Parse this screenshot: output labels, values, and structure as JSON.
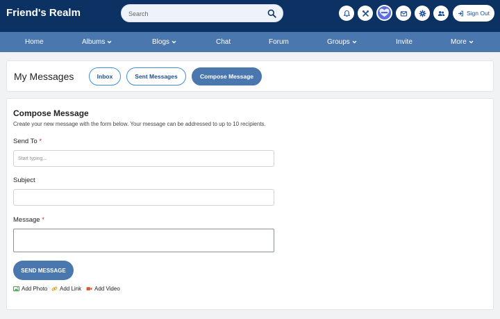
{
  "header": {
    "brand": "Friend's Realm",
    "search_placeholder": "Search",
    "signout_label": "Sign Out"
  },
  "nav": {
    "items": [
      {
        "label": "Home"
      },
      {
        "label": "Albums"
      },
      {
        "label": "Blogs"
      },
      {
        "label": "Chat"
      },
      {
        "label": "Forum"
      },
      {
        "label": "Groups"
      },
      {
        "label": "Invite"
      },
      {
        "label": "More"
      }
    ]
  },
  "messages": {
    "heading": "My Messages",
    "tabs": [
      {
        "label": "Inbox"
      },
      {
        "label": "Sent Messages"
      },
      {
        "label": "Compose Message"
      }
    ]
  },
  "compose": {
    "title": "Compose Message",
    "description": "Create your new message with the form below. Your message can be addressed to up to 10 recipients.",
    "send_to_label": "Send To",
    "send_to_placeholder": "Start typing...",
    "subject_label": "Subject",
    "message_label": "Message",
    "required_mark": "*",
    "send_button": "SEND MESSAGE",
    "attachments": [
      {
        "label": "Add Photo"
      },
      {
        "label": "Add Link"
      },
      {
        "label": "Add Video"
      }
    ]
  },
  "colors": {
    "header_bg": "#0c3264",
    "nav_bg": "#4a77ad",
    "accent": "#4a77ad",
    "required": "#d62b2b",
    "photo_icon": "#3a9b3a",
    "link_icon": "#e0a020",
    "video_icon": "#e0502a"
  },
  "icons": {
    "search": "search-icon",
    "notifications": "bell-icon",
    "tools": "tools-icon",
    "messages": "envelope-icon",
    "settings": "gear-icon",
    "friends": "users-icon",
    "signout": "sign-in-arrow-icon"
  }
}
